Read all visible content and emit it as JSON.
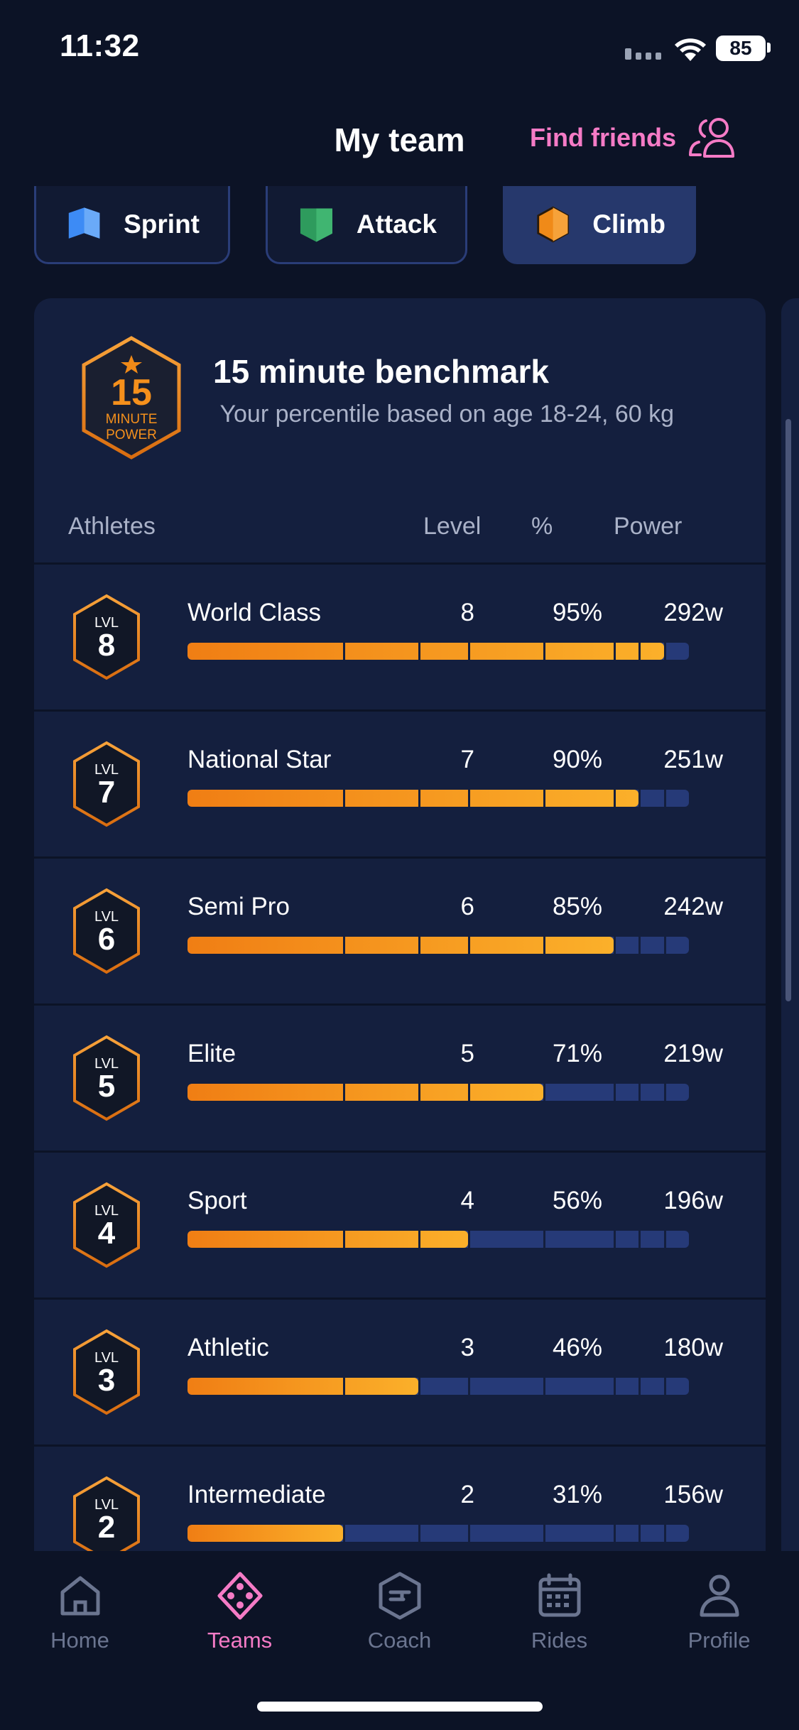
{
  "status_bar": {
    "time": "11:32",
    "battery": "85"
  },
  "header": {
    "title": "My team",
    "find_friends": "Find friends"
  },
  "tabs": [
    {
      "label": "Sprint",
      "icon": "sprint-shield-icon",
      "color": "#3d8bf5",
      "active": false
    },
    {
      "label": "Attack",
      "icon": "attack-shield-icon",
      "color": "#2e9b5d",
      "active": false
    },
    {
      "label": "Climb",
      "icon": "climb-hexagon-icon",
      "color": "#f08a18",
      "active": true
    }
  ],
  "benchmark": {
    "badge_number": "15",
    "badge_line1": "MINUTE",
    "badge_line2": "POWER",
    "title": "15 minute benchmark",
    "subtitle": " Your percentile based on age 18-24, 60 kg"
  },
  "table": {
    "headers": {
      "athletes": "Athletes",
      "level": "Level",
      "percent": "%",
      "power": "Power"
    },
    "lvl_label": "LVL",
    "rows": [
      {
        "lvl": "8",
        "name": "World Class",
        "level": "8",
        "pct": "95%",
        "power": "292w",
        "fill": 0.95
      },
      {
        "lvl": "7",
        "name": "National Star",
        "level": "7",
        "pct": "90%",
        "power": "251w",
        "fill": 0.9
      },
      {
        "lvl": "6",
        "name": "Semi Pro",
        "level": "6",
        "pct": "85%",
        "power": "242w",
        "fill": 0.85
      },
      {
        "lvl": "5",
        "name": "Elite",
        "level": "5",
        "pct": "71%",
        "power": "219w",
        "fill": 0.71
      },
      {
        "lvl": "4",
        "name": "Sport",
        "level": "4",
        "pct": "56%",
        "power": "196w",
        "fill": 0.56
      },
      {
        "lvl": "3",
        "name": "Athletic",
        "level": "3",
        "pct": "46%",
        "power": "180w",
        "fill": 0.46
      },
      {
        "lvl": "2",
        "name": "Intermediate",
        "level": "2",
        "pct": "31%",
        "power": "156w",
        "fill": 0.31
      }
    ]
  },
  "nav": [
    {
      "label": "Home",
      "icon": "home-icon",
      "active": false
    },
    {
      "label": "Teams",
      "icon": "teams-icon",
      "active": true
    },
    {
      "label": "Coach",
      "icon": "coach-icon",
      "active": false
    },
    {
      "label": "Rides",
      "icon": "calendar-icon",
      "active": false
    },
    {
      "label": "Profile",
      "icon": "profile-icon",
      "active": false
    }
  ],
  "colors": {
    "accent_pink": "#f57bc6",
    "bar_orange": "#f5901c",
    "background": "#0c1326",
    "card": "#141f3e"
  }
}
